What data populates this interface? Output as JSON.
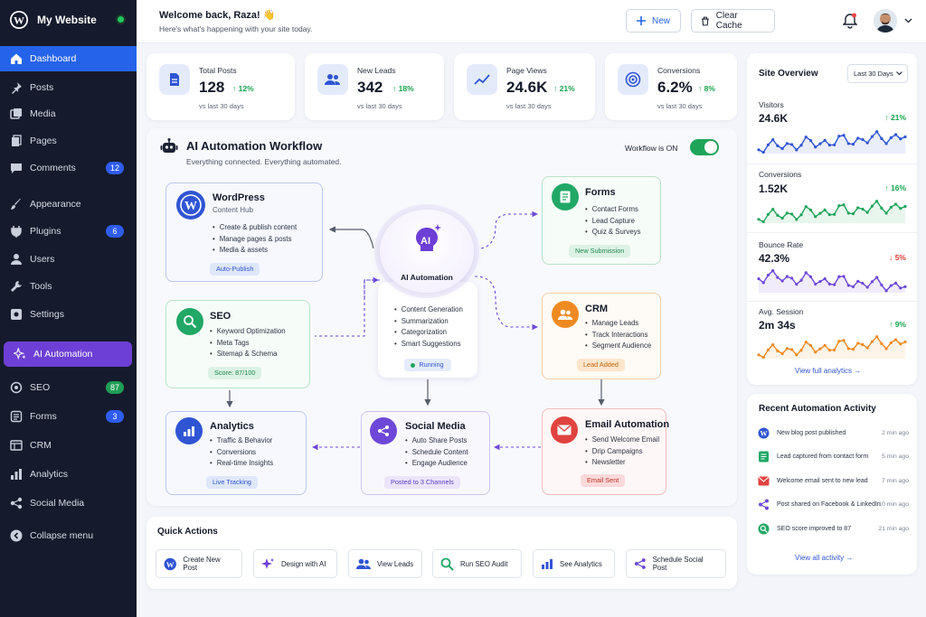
{
  "sidebar": {
    "site_name": "My Website",
    "items": [
      {
        "label": "Dashboard"
      },
      {
        "label": "Posts"
      },
      {
        "label": "Media"
      },
      {
        "label": "Pages"
      },
      {
        "label": "Comments",
        "badge": "12"
      },
      {
        "label": "Appearance"
      },
      {
        "label": "Plugins",
        "badge": "6"
      },
      {
        "label": "Users"
      },
      {
        "label": "Tools"
      },
      {
        "label": "Settings"
      },
      {
        "label": "AI Automation"
      },
      {
        "label": "SEO",
        "badge": "87"
      },
      {
        "label": "Forms",
        "badge": "3"
      },
      {
        "label": "CRM"
      },
      {
        "label": "Analytics"
      },
      {
        "label": "Social Media"
      },
      {
        "label": "Collapse menu"
      }
    ]
  },
  "header": {
    "greeting": "Welcome back, Raza! 👋",
    "subtitle": "Here's what's happening with your site today.",
    "new_label": "New",
    "clear_cache_label": "Clear Cache"
  },
  "stats": [
    {
      "label": "Total Posts",
      "value": "128",
      "trend": "12%",
      "sub": "vs last 30 days"
    },
    {
      "label": "New Leads",
      "value": "342",
      "trend": "18%",
      "sub": "vs last 30 days"
    },
    {
      "label": "Page Views",
      "value": "24.6K",
      "trend": "21%",
      "sub": "vs last 30 days"
    },
    {
      "label": "Conversions",
      "value": "6.2%",
      "trend": "8%",
      "sub": "vs last 30 days"
    }
  ],
  "workflow": {
    "title": "AI Automation Workflow",
    "subtitle": "Everything connected. Everything automated.",
    "toggle_label": "Workflow is ON",
    "center": {
      "label": "AI Automation",
      "ai_text": "AI",
      "items": [
        "Content Generation",
        "Summarization",
        "Categorization",
        "Smart Suggestions"
      ],
      "status": "Running"
    },
    "wordpress": {
      "title": "WordPress",
      "subtitle": "Content Hub",
      "items": [
        "Create & publish content",
        "Manage pages & posts",
        "Media & assets"
      ],
      "pill": "Auto-Publish"
    },
    "seo": {
      "title": "SEO",
      "items": [
        "Keyword Optimization",
        "Meta Tags",
        "Sitemap & Schema"
      ],
      "pill": "Score: 87/100"
    },
    "analytics": {
      "title": "Analytics",
      "items": [
        "Traffic & Behavior",
        "Conversions",
        "Real-time Insights"
      ],
      "pill": "Live Tracking"
    },
    "social": {
      "title": "Social Media",
      "items": [
        "Auto Share Posts",
        "Schedule Content",
        "Engage Audience"
      ],
      "pill": "Posted to 3 Channels"
    },
    "forms": {
      "title": "Forms",
      "items": [
        "Contact Forms",
        "Lead Capture",
        "Quiz & Surveys"
      ],
      "pill": "New Submission"
    },
    "crm": {
      "title": "CRM",
      "items": [
        "Manage Leads",
        "Track Interactions",
        "Segment Audience"
      ],
      "pill": "Lead Added"
    },
    "email": {
      "title": "Email Automation",
      "items": [
        "Send Welcome Email",
        "Drip Campaigns",
        "Newsletter"
      ],
      "pill": "Email Sent"
    }
  },
  "quick_actions": {
    "title": "Quick Actions",
    "items": [
      "Create New Post",
      "Design with AI",
      "View Leads",
      "Run SEO Audit",
      "See Analytics",
      "Schedule Social Post"
    ]
  },
  "overview": {
    "title": "Site Overview",
    "range": "Last 30 Days",
    "metrics": [
      {
        "label": "Visitors",
        "value": "24.6K",
        "trend": "21%",
        "color": "#2f55d4",
        "dir": "up"
      },
      {
        "label": "Conversions",
        "value": "1.52K",
        "trend": "16%",
        "color": "#1fa55a",
        "dir": "up"
      },
      {
        "label": "Bounce Rate",
        "value": "42.3%",
        "trend": "5%",
        "color": "#6d48d8",
        "dir": "down"
      },
      {
        "label": "Avg. Session",
        "value": "2m 34s",
        "trend": "9%",
        "color": "#ef8a22",
        "dir": "up"
      }
    ],
    "link": "View full analytics"
  },
  "activity": {
    "title": "Recent Automation Activity",
    "items": [
      {
        "text": "New blog post published",
        "time": "2 min ago"
      },
      {
        "text": "Lead captured from contact form",
        "time": "5 min ago"
      },
      {
        "text": "Welcome email sent to new lead",
        "time": "7 min ago"
      },
      {
        "text": "Post shared on Facebook & LinkedIn",
        "time": "10 min ago"
      },
      {
        "text": "SEO score improved to 87",
        "time": "21 min ago"
      }
    ],
    "link": "View all activity"
  }
}
